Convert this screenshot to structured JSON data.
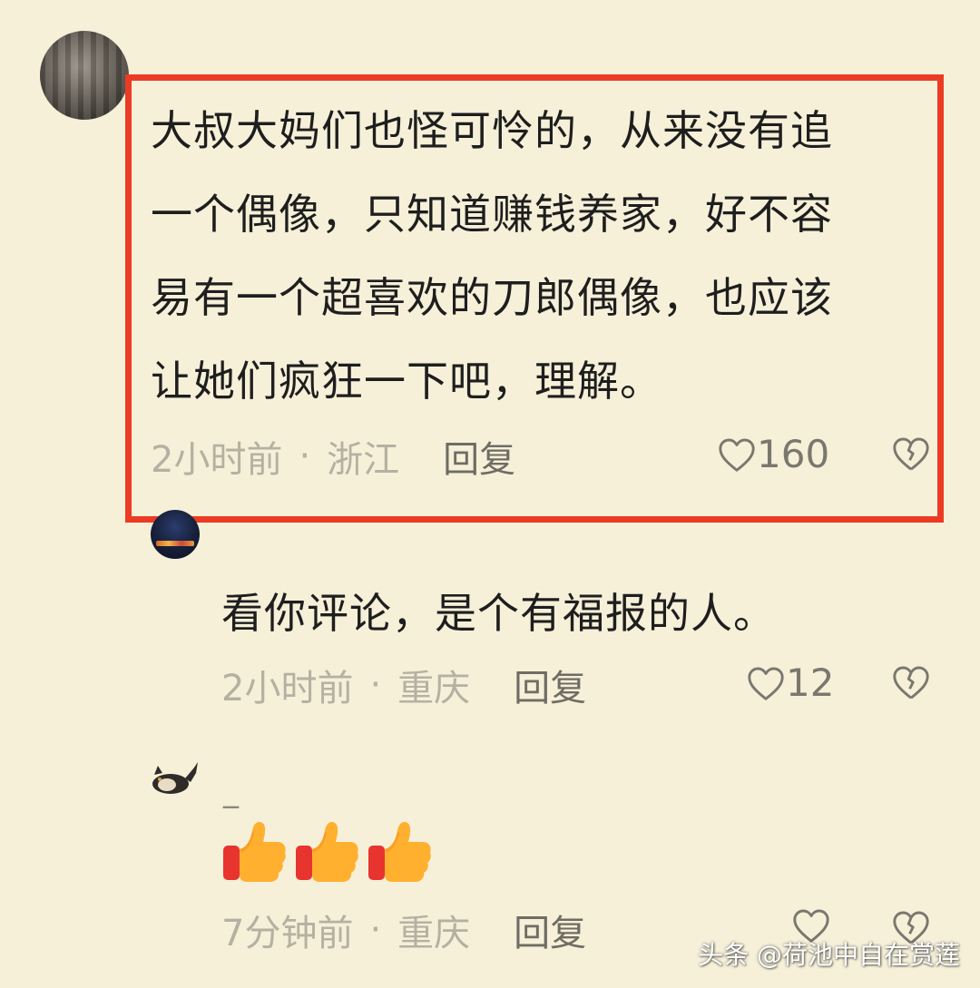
{
  "main_comment": {
    "lines": [
      "大叔大妈们也怪可怜的，从来没有追",
      "一个偶像，只知道赚钱养家，好不容",
      "易有一个超喜欢的刀郎偶像，也应该",
      "让她们疯狂一下吧，理解。"
    ],
    "time": "2小时前",
    "separator": "·",
    "location": "浙江",
    "reply_label": "回复",
    "likes": "160"
  },
  "reply1": {
    "text": "看你评论，是个有福报的人。",
    "time": "2小时前",
    "separator": "·",
    "location": "重庆",
    "reply_label": "回复",
    "likes": "12"
  },
  "reply2": {
    "name": "_",
    "emoji_name": "thumbs-up",
    "emoji_count": 3,
    "time": "7分钟前",
    "separator": "·",
    "location": "重庆",
    "reply_label": "回复"
  },
  "watermark": "头条 @荷池中自在赏莲",
  "colors": {
    "background": "#f6f0d9",
    "highlight_border": "#ec3b24",
    "meta_text": "#b5b1a2",
    "reply_text": "#6f6c64"
  }
}
